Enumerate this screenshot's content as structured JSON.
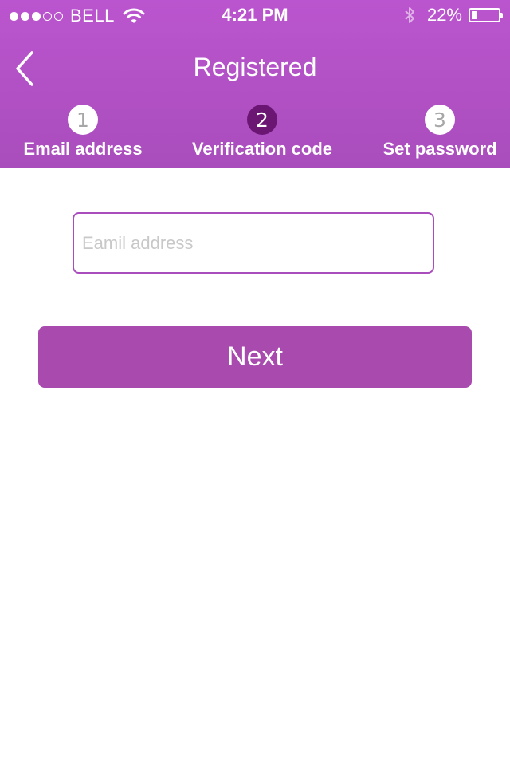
{
  "statusbar": {
    "carrier": "BELL",
    "time": "4:21 PM",
    "battery_percent": "22%",
    "battery_level": 0.22,
    "signal_bars_filled": 3,
    "signal_bars_total": 5
  },
  "nav": {
    "title": "Registered",
    "back_icon": "chevron-left-icon"
  },
  "steps": [
    {
      "number": "1",
      "label": "Email address",
      "active": false
    },
    {
      "number": "2",
      "label": "Verification code",
      "active": true
    },
    {
      "number": "3",
      "label": "Set password",
      "active": false
    }
  ],
  "form": {
    "email_placeholder": "Eamil address",
    "email_value": "",
    "next_label": "Next"
  },
  "colors": {
    "header": "#b150c6",
    "accent": "#a94aae",
    "active_step": "#6a1672"
  }
}
